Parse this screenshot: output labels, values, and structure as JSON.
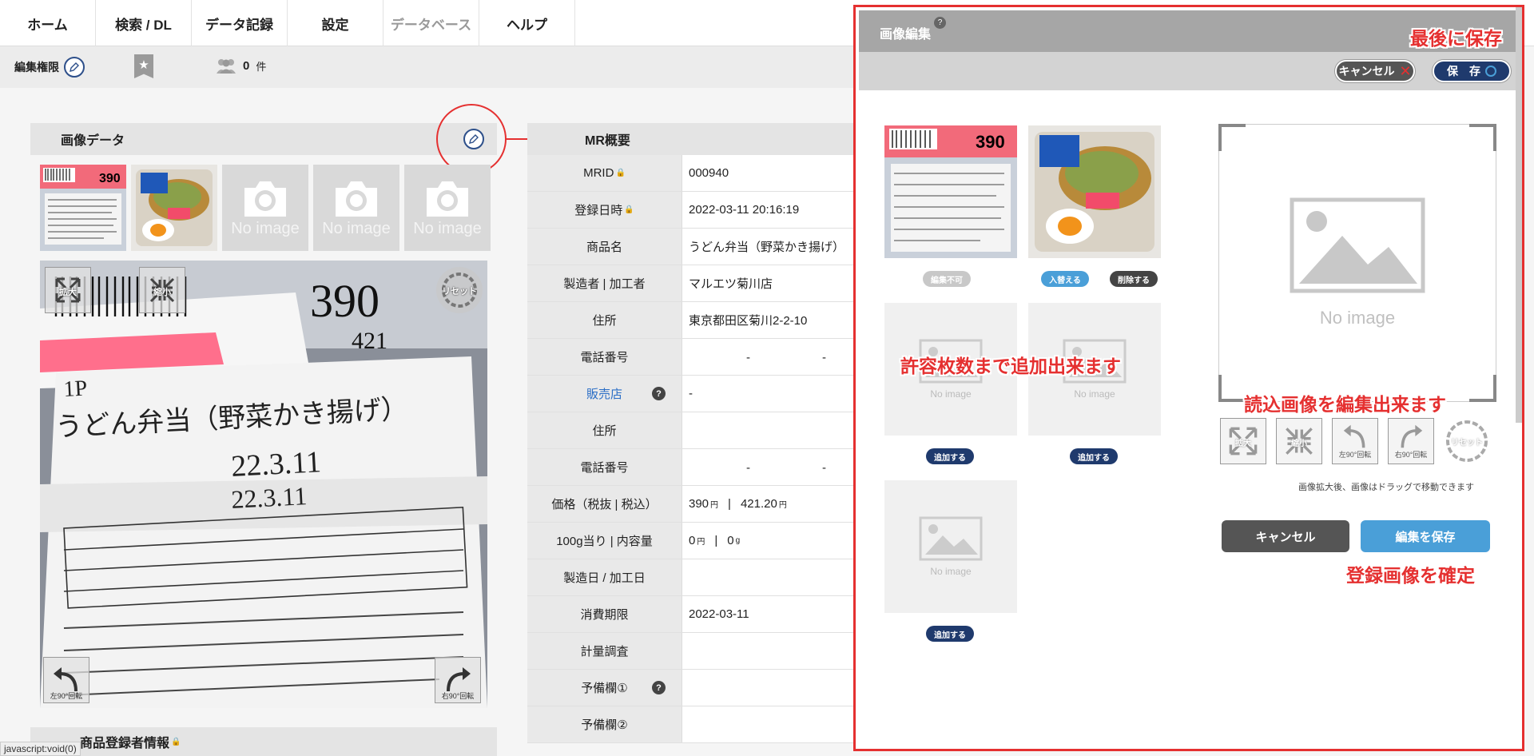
{
  "nav": {
    "items": [
      "ホーム",
      "検索 / DL",
      "データ記録",
      "設定",
      "データベース",
      "ヘルプ"
    ]
  },
  "subbar": {
    "permission_label": "編集権限",
    "count": "0",
    "count_unit": "件"
  },
  "image_panel": {
    "title": "画像データ",
    "no_image": "No image",
    "zoom_in": "拡大",
    "zoom_out": "縮小",
    "reset": "リセット",
    "rotate_left": "左90°回転",
    "rotate_right": "右90°回転"
  },
  "mr": {
    "title": "MR概要",
    "rows": [
      {
        "label": "MRID",
        "value": "000940"
      },
      {
        "label": "登録日時",
        "value": "2022-03-11 20:16:19"
      },
      {
        "label": "商品名",
        "value": "うどん弁当（野菜かき揚げ）"
      },
      {
        "label": "製造者 | 加工者",
        "value": "マルエツ菊川店"
      },
      {
        "label": "住所",
        "value": "東京都田区菊川2-2-10"
      },
      {
        "label": "電話番号",
        "value": "-　　　　　　-"
      },
      {
        "label": "販売店",
        "value": "-"
      },
      {
        "label": "住所",
        "value": ""
      },
      {
        "label": "電話番号",
        "value": "-　　　　　　-"
      },
      {
        "label": "価格（税抜 | 税込）",
        "value": "390",
        "value_unit": "円",
        "sep": "|",
        "value2": "421.20",
        "value2_unit": "円"
      },
      {
        "label": "100g当り | 内容量",
        "value": "0",
        "value_unit": "円",
        "sep": "|",
        "value2": "0",
        "value2_unit": "g"
      },
      {
        "label": "製造日 / 加工日",
        "value": ""
      },
      {
        "label": "消費期限",
        "value": "2022-03-11"
      },
      {
        "label": "計量調査",
        "value": ""
      },
      {
        "label": "予備欄①",
        "value": ""
      },
      {
        "label": "予備欄②",
        "value": ""
      }
    ]
  },
  "registrant": {
    "title": "商品登録者情報"
  },
  "status_tip": "javascript:void(0)",
  "editor": {
    "title": "画像編集",
    "cancel": "キャンセル",
    "save": "保　存",
    "not_editable": "編集不可",
    "replace": "入替える",
    "delete": "削除する",
    "add": "追加する",
    "no_image": "No image",
    "tools": [
      "拡大",
      "縮小",
      "左90°回転",
      "右90°回転",
      "リセット"
    ],
    "hint": "画像拡大後、画像はドラッグで移動できます",
    "cancel_big": "キャンセル",
    "save_big": "編集を保存"
  },
  "annotations": {
    "save_last": "最後に保存",
    "add_upto": "許容枚数まで追加出来ます",
    "edit_loaded": "読込画像を編集出来ます",
    "confirm": "登録画像を確定"
  },
  "colors": {
    "annotation": "#e53030",
    "navy": "#1f3a6d",
    "blue": "#4a9fd8",
    "dark": "#555555"
  }
}
